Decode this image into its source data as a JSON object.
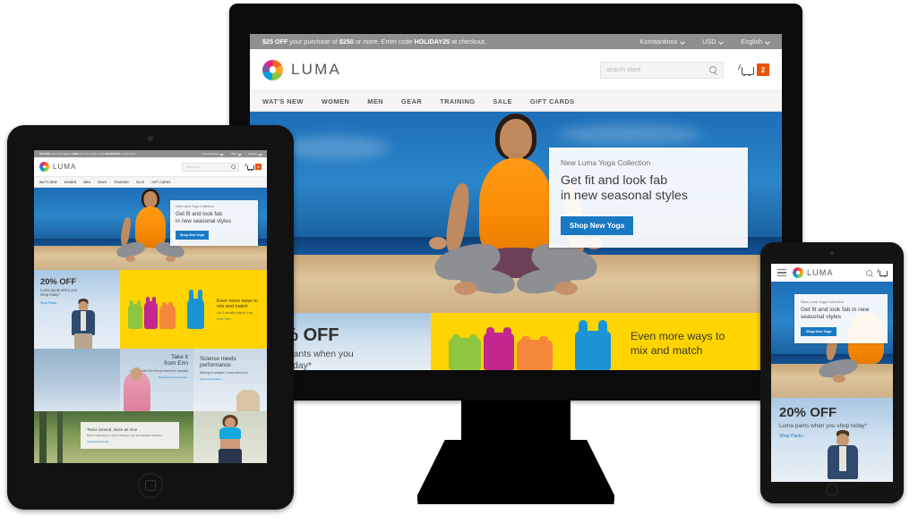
{
  "site": {
    "promo": {
      "amount": "$25 OFF",
      "text_mid": " your purchase of ",
      "threshold": "$250",
      "text_after": " or more.  Enter code ",
      "code": "HOLIDAY25",
      "text_end": " at checkout.",
      "account": "Konstantinos",
      "currency": "USD",
      "language": "English"
    },
    "brand": "LUMA",
    "search_placeholder": "search store",
    "cart_count": "2",
    "nav": [
      "WAT'S NEW",
      "WOMEN",
      "MEN",
      "GEAR",
      "TRAINING",
      "SALE",
      "GIFT CARDS"
    ],
    "hero": {
      "kicker": "New Luma Yoga Collection",
      "title_line1": "Get fit and look fab",
      "title_line2": "in new seasonal styles",
      "title_phone": "Get fit and look fab in new seasonal styles",
      "cta": "Shop New Yoga"
    },
    "pants_promo": {
      "title": "20% OFF",
      "sub_line1": "Luma pants when you",
      "sub_line2": "shop today*",
      "sub_full": "Luma pants when you shop today*",
      "link": "Shop Pants  ›"
    },
    "tees_promo": {
      "line1": "Even more ways to",
      "line2": "mix and match",
      "sub": "Our 5 versatile picks in 4 top",
      "link": "Shop Tees  ›"
    },
    "erin_tile": {
      "title_line1": "Take it",
      "title_line2": "from Erin",
      "sub": "Luma founder Erin Renny shares her favorites",
      "link": "Shop Erin Recommends  ›"
    },
    "science_tile": {
      "title_line1": "Science meets",
      "title_line2": "performance",
      "sub": "Wicking to navigate, Luma covers you",
      "link": "Shop Performance  ›"
    },
    "eco_tile": {
      "title": "Twice around, twice as nice",
      "sub": "Find conscientious, comfy clothing in our eco-friendly collection",
      "link": "Shop Eco-Friendly  ›"
    }
  },
  "devices": {
    "monitor_label": "desktop monitor",
    "tablet_label": "tablet",
    "phone_label": "smartphone"
  },
  "colors": {
    "accent_blue": "#1979c3",
    "promo_yellow": "#ffd400",
    "badge_orange": "#eb5202",
    "promo_bar_grey": "#8f8f8f",
    "tank_green": "#8dc63f",
    "tank_magenta": "#c2268f",
    "tank_orange": "#f5873a",
    "tank_blue": "#1b94d4"
  }
}
